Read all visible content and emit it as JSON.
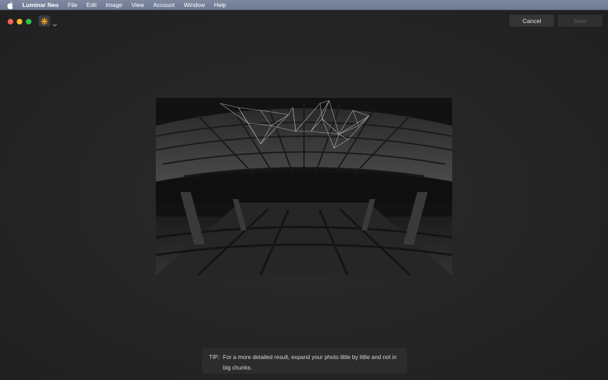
{
  "menubar": {
    "apple_icon": "apple-icon",
    "items": [
      "Luminar Neo",
      "File",
      "Edit",
      "Image",
      "View",
      "Account",
      "Window",
      "Help"
    ]
  },
  "toolbar": {
    "logo_icon": "luminar-logo-icon",
    "dropdown_icon": "chevron-down-icon",
    "cancel_label": "Cancel",
    "save_label": "Save"
  },
  "tip": {
    "label": "TIP:",
    "text": "For a more detailed result, expand your photo little by little and not in big chunks."
  },
  "colors": {
    "accent": "#f5a623",
    "traffic_red": "#fe5f57",
    "traffic_yellow": "#febc2e",
    "traffic_green": "#28c840"
  }
}
